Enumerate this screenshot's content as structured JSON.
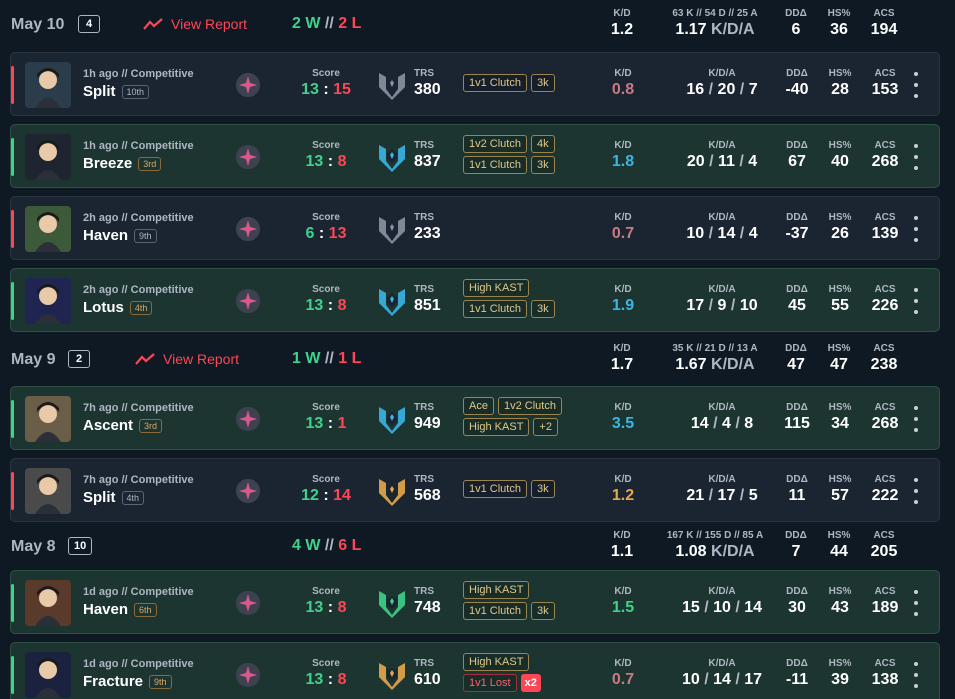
{
  "days": [
    {
      "date": "May 10",
      "count": "4",
      "report": "View Report",
      "wins": "2 W",
      "losses": "2 L",
      "sep": "//",
      "kd_label": "K/D",
      "kd": "1.2",
      "kda_label": "63 K // 54 D // 25 A",
      "kda": "1.17",
      "kda_unit": "K/D/A",
      "dd_label": "DDΔ",
      "dd": "6",
      "hs_label": "HS%",
      "hs": "36",
      "acs_label": "ACS",
      "acs": "194"
    },
    {
      "date": "May 9",
      "count": "2",
      "report": "View Report",
      "wins": "1 W",
      "losses": "1 L",
      "sep": "//",
      "kd_label": "K/D",
      "kd": "1.7",
      "kda_label": "35 K // 21 D // 13 A",
      "kda": "1.67",
      "kda_unit": "K/D/A",
      "dd_label": "DDΔ",
      "dd": "47",
      "hs_label": "HS%",
      "hs": "47",
      "acs_label": "ACS",
      "acs": "238"
    },
    {
      "date": "May 8",
      "count": "10",
      "report": "",
      "wins": "4 W",
      "losses": "6 L",
      "sep": "//",
      "kd_label": "K/D",
      "kd": "1.1",
      "kda_label": "167 K // 155 D // 85 A",
      "kda": "1.08",
      "kda_unit": "K/D/A",
      "dd_label": "DDΔ",
      "dd": "7",
      "hs_label": "HS%",
      "hs": "44",
      "acs_label": "ACS",
      "acs": "205"
    }
  ],
  "labels": {
    "score": "Score",
    "trs": "TRS",
    "kd": "K/D",
    "kda": "K/D/A",
    "dd": "DDΔ",
    "hs": "HS%",
    "acs": "ACS",
    "colon": ":",
    "slash": "/"
  },
  "matches": [
    {
      "result": "loss",
      "meta": "1h ago // Competitive",
      "map": "Split",
      "place": "10th",
      "score_a": "13",
      "score_b": "15",
      "trs": "380",
      "trs_tier": "gray",
      "badges": [
        [
          "1v1 Clutch",
          "3k"
        ]
      ],
      "kd": "0.8",
      "kd_color": "#c77b84",
      "k": "16",
      "d": "20",
      "a": "7",
      "dd": "-40",
      "hs": "28",
      "acs": "153",
      "agent_color": "#2b3d4a"
    },
    {
      "result": "win",
      "meta": "1h ago // Competitive",
      "map": "Breeze",
      "place": "3rd",
      "score_a": "13",
      "score_b": "8",
      "trs": "837",
      "trs_tier": "blue",
      "badges": [
        [
          "1v2 Clutch",
          "4k"
        ],
        [
          "1v1 Clutch",
          "3k"
        ]
      ],
      "kd": "1.8",
      "kd_color": "#3ab5e6",
      "k": "20",
      "d": "11",
      "a": "4",
      "dd": "67",
      "hs": "40",
      "acs": "268",
      "agent_color": "#1e2530"
    },
    {
      "result": "loss",
      "meta": "2h ago // Competitive",
      "map": "Haven",
      "place": "9th",
      "score_a": "6",
      "score_b": "13",
      "trs": "233",
      "trs_tier": "gray",
      "badges": [],
      "kd": "0.7",
      "kd_color": "#c77b84",
      "k": "10",
      "d": "14",
      "a": "4",
      "dd": "-37",
      "hs": "26",
      "acs": "139",
      "agent_color": "#3c5a3a"
    },
    {
      "result": "win",
      "meta": "2h ago // Competitive",
      "map": "Lotus",
      "place": "4th",
      "score_a": "13",
      "score_b": "8",
      "trs": "851",
      "trs_tier": "blue",
      "badges": [
        [
          "High KAST"
        ],
        [
          "1v1 Clutch",
          "3k"
        ]
      ],
      "kd": "1.9",
      "kd_color": "#3ab5e6",
      "k": "17",
      "d": "9",
      "a": "10",
      "dd": "45",
      "hs": "55",
      "acs": "226",
      "agent_color": "#1f2450"
    },
    {
      "result": "win",
      "meta": "7h ago // Competitive",
      "map": "Ascent",
      "place": "3rd",
      "score_a": "13",
      "score_b": "1",
      "trs": "949",
      "trs_tier": "blue",
      "badges": [
        [
          "Ace",
          "1v2 Clutch"
        ],
        [
          "High KAST",
          "+2"
        ]
      ],
      "kd": "3.5",
      "kd_color": "#3ab5e6",
      "k": "14",
      "d": "4",
      "a": "8",
      "dd": "115",
      "hs": "34",
      "acs": "268",
      "agent_color": "#6a5e48"
    },
    {
      "result": "loss",
      "meta": "7h ago // Competitive",
      "map": "Split",
      "place": "4th",
      "score_a": "12",
      "score_b": "14",
      "trs": "568",
      "trs_tier": "gold",
      "badges": [
        [
          "1v1 Clutch",
          "3k"
        ]
      ],
      "kd": "1.2",
      "kd_color": "#e6a94a",
      "k": "21",
      "d": "17",
      "a": "5",
      "dd": "11",
      "hs": "57",
      "acs": "222",
      "agent_color": "#4a4a4a"
    },
    {
      "result": "win",
      "meta": "1d ago // Competitive",
      "map": "Haven",
      "place": "6th",
      "score_a": "13",
      "score_b": "8",
      "trs": "748",
      "trs_tier": "green",
      "badges": [
        [
          "High KAST"
        ],
        [
          "1v1 Clutch",
          "3k"
        ]
      ],
      "kd": "1.5",
      "kd_color": "#3fd28a",
      "k": "15",
      "d": "10",
      "a": "14",
      "dd": "30",
      "hs": "43",
      "acs": "189",
      "agent_color": "#5a3a2a"
    },
    {
      "result": "win",
      "meta": "1d ago // Competitive",
      "map": "Fracture",
      "place": "9th",
      "score_a": "13",
      "score_b": "8",
      "trs": "610",
      "trs_tier": "gold",
      "badges": [
        [
          "High KAST"
        ],
        [
          "1v1 Lost",
          "x2"
        ]
      ],
      "kd": "0.7",
      "kd_color": "#c77b84",
      "k": "10",
      "d": "14",
      "a": "17",
      "dd": "-11",
      "hs": "39",
      "acs": "138",
      "agent_color": "#1a2240"
    }
  ],
  "colors": {
    "win": "#3fd28a",
    "loss": "#ff4655",
    "accent": "#ff4655",
    "gold": "#e6a94a",
    "blue": "#3ab5e6",
    "gray": "#8a94a3",
    "green": "#3fd28a"
  }
}
